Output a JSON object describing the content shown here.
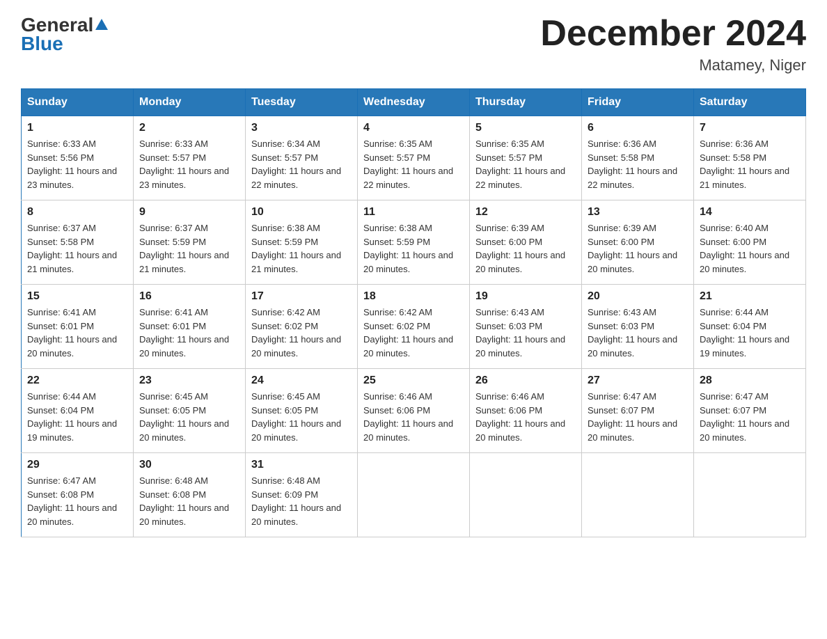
{
  "header": {
    "logo_general": "General",
    "logo_blue": "Blue",
    "month_year": "December 2024",
    "location": "Matamey, Niger"
  },
  "days_of_week": [
    "Sunday",
    "Monday",
    "Tuesday",
    "Wednesday",
    "Thursday",
    "Friday",
    "Saturday"
  ],
  "weeks": [
    [
      {
        "day": "1",
        "sunrise": "6:33 AM",
        "sunset": "5:56 PM",
        "daylight": "11 hours and 23 minutes."
      },
      {
        "day": "2",
        "sunrise": "6:33 AM",
        "sunset": "5:57 PM",
        "daylight": "11 hours and 23 minutes."
      },
      {
        "day": "3",
        "sunrise": "6:34 AM",
        "sunset": "5:57 PM",
        "daylight": "11 hours and 22 minutes."
      },
      {
        "day": "4",
        "sunrise": "6:35 AM",
        "sunset": "5:57 PM",
        "daylight": "11 hours and 22 minutes."
      },
      {
        "day": "5",
        "sunrise": "6:35 AM",
        "sunset": "5:57 PM",
        "daylight": "11 hours and 22 minutes."
      },
      {
        "day": "6",
        "sunrise": "6:36 AM",
        "sunset": "5:58 PM",
        "daylight": "11 hours and 22 minutes."
      },
      {
        "day": "7",
        "sunrise": "6:36 AM",
        "sunset": "5:58 PM",
        "daylight": "11 hours and 21 minutes."
      }
    ],
    [
      {
        "day": "8",
        "sunrise": "6:37 AM",
        "sunset": "5:58 PM",
        "daylight": "11 hours and 21 minutes."
      },
      {
        "day": "9",
        "sunrise": "6:37 AM",
        "sunset": "5:59 PM",
        "daylight": "11 hours and 21 minutes."
      },
      {
        "day": "10",
        "sunrise": "6:38 AM",
        "sunset": "5:59 PM",
        "daylight": "11 hours and 21 minutes."
      },
      {
        "day": "11",
        "sunrise": "6:38 AM",
        "sunset": "5:59 PM",
        "daylight": "11 hours and 20 minutes."
      },
      {
        "day": "12",
        "sunrise": "6:39 AM",
        "sunset": "6:00 PM",
        "daylight": "11 hours and 20 minutes."
      },
      {
        "day": "13",
        "sunrise": "6:39 AM",
        "sunset": "6:00 PM",
        "daylight": "11 hours and 20 minutes."
      },
      {
        "day": "14",
        "sunrise": "6:40 AM",
        "sunset": "6:00 PM",
        "daylight": "11 hours and 20 minutes."
      }
    ],
    [
      {
        "day": "15",
        "sunrise": "6:41 AM",
        "sunset": "6:01 PM",
        "daylight": "11 hours and 20 minutes."
      },
      {
        "day": "16",
        "sunrise": "6:41 AM",
        "sunset": "6:01 PM",
        "daylight": "11 hours and 20 minutes."
      },
      {
        "day": "17",
        "sunrise": "6:42 AM",
        "sunset": "6:02 PM",
        "daylight": "11 hours and 20 minutes."
      },
      {
        "day": "18",
        "sunrise": "6:42 AM",
        "sunset": "6:02 PM",
        "daylight": "11 hours and 20 minutes."
      },
      {
        "day": "19",
        "sunrise": "6:43 AM",
        "sunset": "6:03 PM",
        "daylight": "11 hours and 20 minutes."
      },
      {
        "day": "20",
        "sunrise": "6:43 AM",
        "sunset": "6:03 PM",
        "daylight": "11 hours and 20 minutes."
      },
      {
        "day": "21",
        "sunrise": "6:44 AM",
        "sunset": "6:04 PM",
        "daylight": "11 hours and 19 minutes."
      }
    ],
    [
      {
        "day": "22",
        "sunrise": "6:44 AM",
        "sunset": "6:04 PM",
        "daylight": "11 hours and 19 minutes."
      },
      {
        "day": "23",
        "sunrise": "6:45 AM",
        "sunset": "6:05 PM",
        "daylight": "11 hours and 20 minutes."
      },
      {
        "day": "24",
        "sunrise": "6:45 AM",
        "sunset": "6:05 PM",
        "daylight": "11 hours and 20 minutes."
      },
      {
        "day": "25",
        "sunrise": "6:46 AM",
        "sunset": "6:06 PM",
        "daylight": "11 hours and 20 minutes."
      },
      {
        "day": "26",
        "sunrise": "6:46 AM",
        "sunset": "6:06 PM",
        "daylight": "11 hours and 20 minutes."
      },
      {
        "day": "27",
        "sunrise": "6:47 AM",
        "sunset": "6:07 PM",
        "daylight": "11 hours and 20 minutes."
      },
      {
        "day": "28",
        "sunrise": "6:47 AM",
        "sunset": "6:07 PM",
        "daylight": "11 hours and 20 minutes."
      }
    ],
    [
      {
        "day": "29",
        "sunrise": "6:47 AM",
        "sunset": "6:08 PM",
        "daylight": "11 hours and 20 minutes."
      },
      {
        "day": "30",
        "sunrise": "6:48 AM",
        "sunset": "6:08 PM",
        "daylight": "11 hours and 20 minutes."
      },
      {
        "day": "31",
        "sunrise": "6:48 AM",
        "sunset": "6:09 PM",
        "daylight": "11 hours and 20 minutes."
      },
      null,
      null,
      null,
      null
    ]
  ]
}
